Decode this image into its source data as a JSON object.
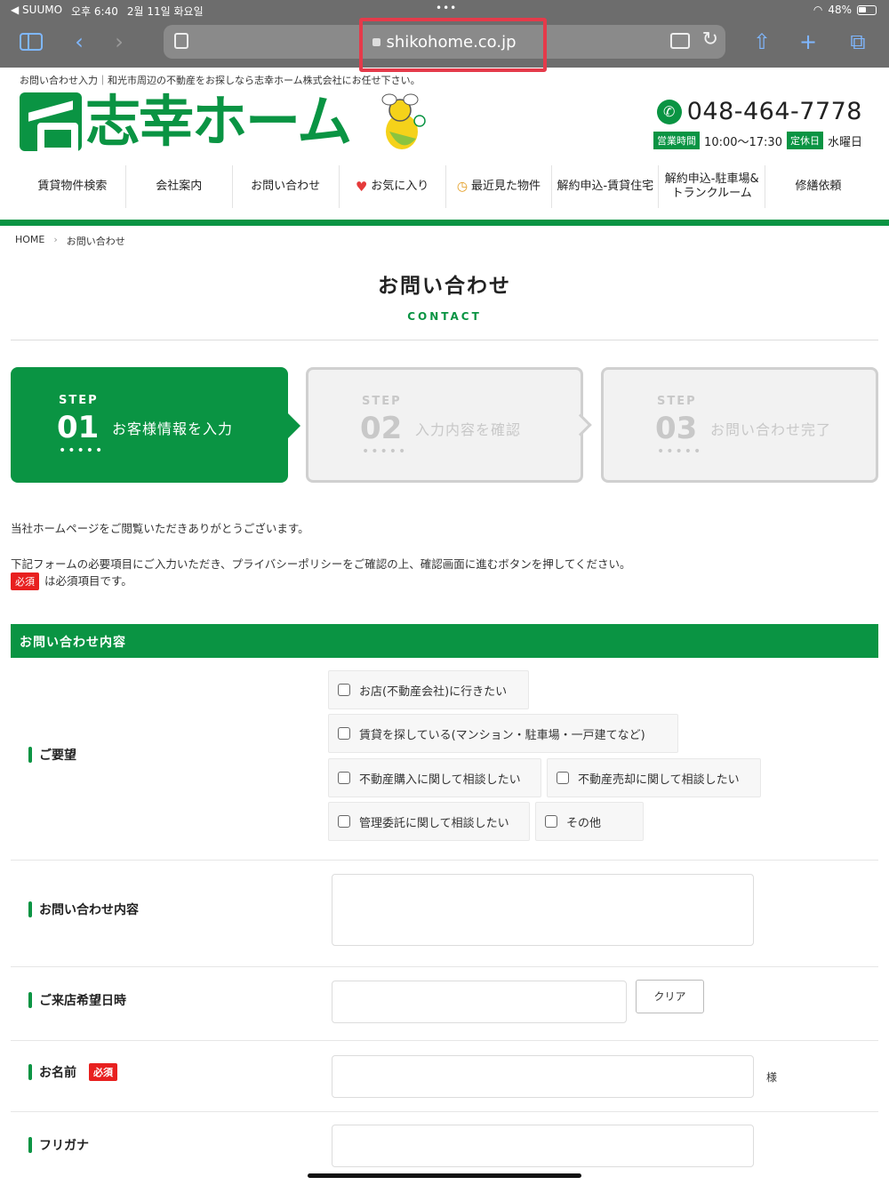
{
  "status": {
    "back_app": "◀ SUUMO",
    "time": "오후 6:40",
    "date": "2월 11일 화요일",
    "battery": "48%"
  },
  "browser": {
    "url": "shikohome.co.jp"
  },
  "site": {
    "tagline": "お問い合わせ入力｜和光市周辺の不動産をお探しなら志幸ホーム株式会社にお任せ下さい。",
    "logo_text": "志幸ホーム",
    "phone": "048-464-7778",
    "hours_label": "営業時間",
    "hours": "10:00〜17:30",
    "holiday_label": "定休日",
    "holiday": "水曜日",
    "nav": [
      "賃貸物件検索",
      "会社案内",
      "お問い合わせ",
      "お気に入り",
      "最近見た物件",
      "解約申込-賃貸住宅",
      "解約申込-駐車場&トランクルーム",
      "修繕依頼"
    ]
  },
  "breadcrumb": {
    "home": "HOME",
    "current": "お問い合わせ"
  },
  "page": {
    "title": "お問い合わせ",
    "subtitle": "CONTACT"
  },
  "steps": [
    {
      "label": "STEP",
      "num": "01",
      "text": "お客様情報を入力",
      "dots": "•••••"
    },
    {
      "label": "STEP",
      "num": "02",
      "text": "入力内容を確認",
      "dots": "•••••"
    },
    {
      "label": "STEP",
      "num": "03",
      "text": "お問い合わせ完了",
      "dots": "•••••"
    }
  ],
  "intro": {
    "line1": "当社ホームページをご閲覧いただきありがとうございます。",
    "line2": "下記フォームの必要項目にご入力いただき、プライバシーポリシーをご確認の上、確認画面に進むボタンを押してください。",
    "required_tag": "必須",
    "line3": "は必須項目です。"
  },
  "form": {
    "section_title": "お問い合わせ内容",
    "request_label": "ご要望",
    "options": [
      "お店(不動産会社)に行きたい",
      "賃貸を探している(マンション・駐車場・一戸建てなど)",
      "不動産購入に関して相談したい",
      "不動産売却に関して相談したい",
      "管理委託に関して相談したい",
      "その他"
    ],
    "content_label": "お問い合わせ内容",
    "visit_label": "ご来店希望日時",
    "clear_button": "クリア",
    "name_label": "お名前",
    "name_required": "必須",
    "name_suffix": "様",
    "kana_label": "フリガナ"
  }
}
